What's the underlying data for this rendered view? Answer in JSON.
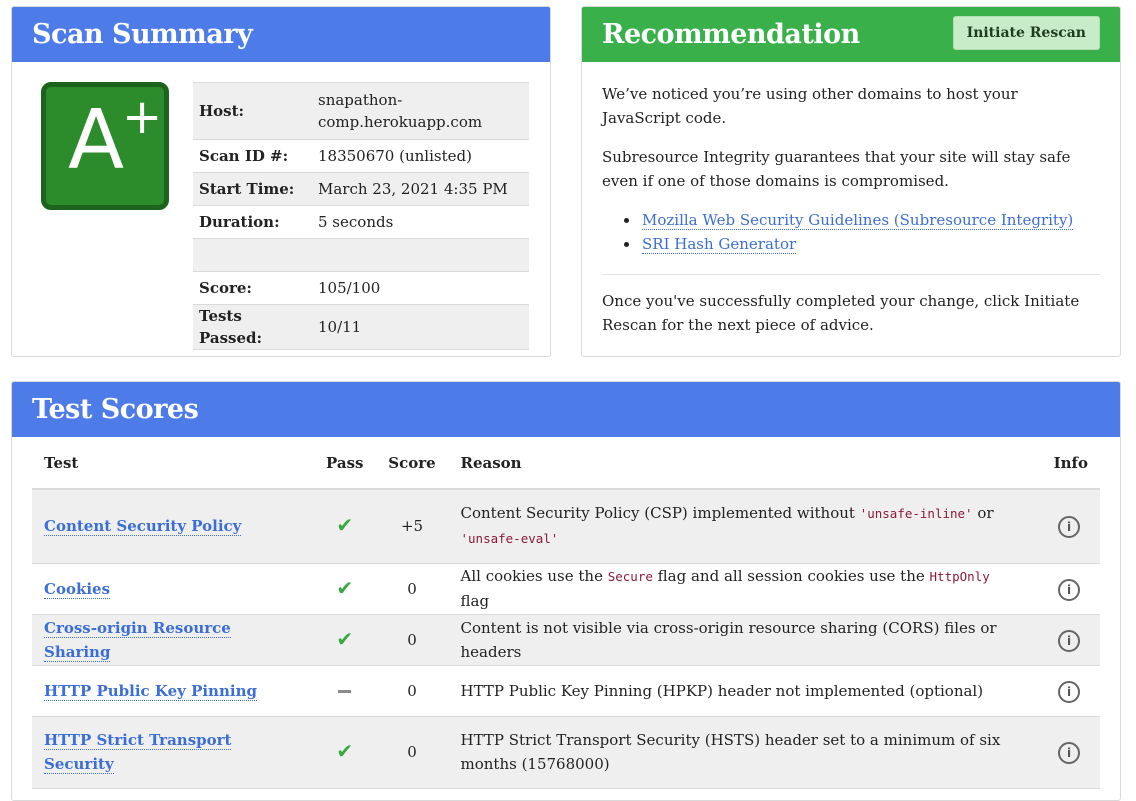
{
  "scan_summary": {
    "title": "Scan Summary",
    "grade_letter": "A",
    "grade_modifier": "+",
    "host_label": "Host:",
    "host": "snapathon-comp.herokuapp.com",
    "scan_id_label": "Scan ID #:",
    "scan_id": "18350670 (unlisted)",
    "start_time_label": "Start Time:",
    "start_time": "March 23, 2021 4:35 PM",
    "duration_label": "Duration:",
    "duration": "5 seconds",
    "score_label": "Score:",
    "score": "105/100",
    "tests_passed_label": "Tests Passed:",
    "tests_passed": "10/11"
  },
  "recommendation": {
    "title": "Recommendation",
    "rescan_button": "Initiate Rescan",
    "p1": "We’ve noticed you’re using other domains to host your JavaScript code.",
    "p2": "Subresource Integrity guarantees that your site will stay safe even if one of those domains is compromised.",
    "link1": "Mozilla Web Security Guidelines (Subresource Integrity)",
    "link2": "SRI Hash Generator",
    "p3": "Once you've successfully completed your change, click Initiate Rescan for the next piece of advice."
  },
  "test_scores": {
    "title": "Test Scores",
    "col_test": "Test",
    "col_pass": "Pass",
    "col_score": "Score",
    "col_reason": "Reason",
    "col_info": "Info",
    "rows": [
      {
        "test": "Content Security Policy",
        "pass": "check",
        "score": "+5",
        "reason_a": "Content Security Policy (CSP) implemented without ",
        "code_a": "'unsafe-inline'",
        "reason_b": " or ",
        "code_b": "'unsafe-eval'",
        "reason_c": ""
      },
      {
        "test": "Cookies",
        "pass": "check",
        "score": "0",
        "reason_a": "All cookies use the ",
        "code_a": "Secure",
        "reason_b": " flag and all session cookies use the ",
        "code_b": "HttpOnly",
        "reason_c": " flag"
      },
      {
        "test": "Cross-origin Resource Sharing",
        "pass": "check",
        "score": "0",
        "reason_a": "Content is not visible via cross-origin resource sharing (CORS) files or headers",
        "code_a": "",
        "reason_b": "",
        "code_b": "",
        "reason_c": ""
      },
      {
        "test": "HTTP Public Key Pinning",
        "pass": "dash",
        "score": "0",
        "reason_a": "HTTP Public Key Pinning (HPKP) header not implemented (optional)",
        "code_a": "",
        "reason_b": "",
        "code_b": "",
        "reason_c": ""
      },
      {
        "test": "HTTP Strict Transport Security",
        "pass": "check",
        "score": "0",
        "reason_a": "HTTP Strict Transport Security (HSTS) header set to a minimum of six months (15768000)",
        "code_a": "",
        "reason_b": "",
        "code_b": "",
        "reason_c": ""
      }
    ]
  }
}
